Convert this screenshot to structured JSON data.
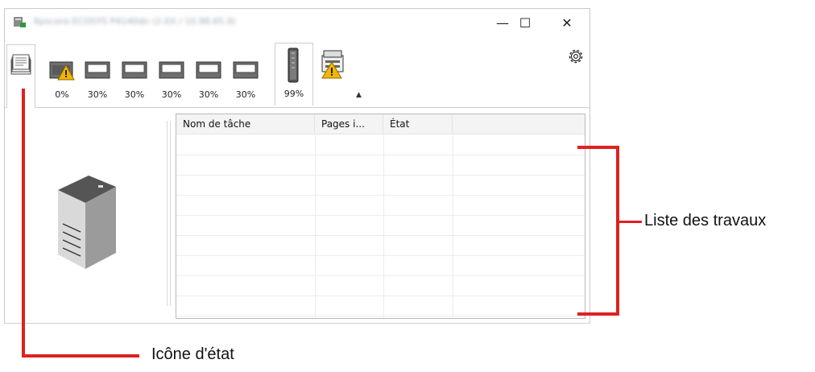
{
  "window": {
    "title": "Kyocera ECOSYS P4140dn (2-XX / 10.98.65.9)",
    "controls": {
      "minimize": "—",
      "maximize": "☐",
      "close": "✕"
    }
  },
  "toolbar": {
    "trays": [
      {
        "level": "0%",
        "warning": true
      },
      {
        "level": "30%",
        "warning": false
      },
      {
        "level": "30%",
        "warning": false
      },
      {
        "level": "30%",
        "warning": false
      },
      {
        "level": "30%",
        "warning": false
      },
      {
        "level": "30%",
        "warning": false
      }
    ],
    "toner_level": "99%",
    "device_warning": true,
    "collapse_glyph": "▲",
    "colors": {
      "warning": "#f2b600",
      "callout_line": "#e02020"
    }
  },
  "job_list": {
    "columns": [
      "Nom de tâche",
      "Pages i...",
      "État",
      ""
    ],
    "rows": []
  },
  "callouts": {
    "job_list": "Liste des travaux",
    "status_icon": "Icône d'état"
  }
}
